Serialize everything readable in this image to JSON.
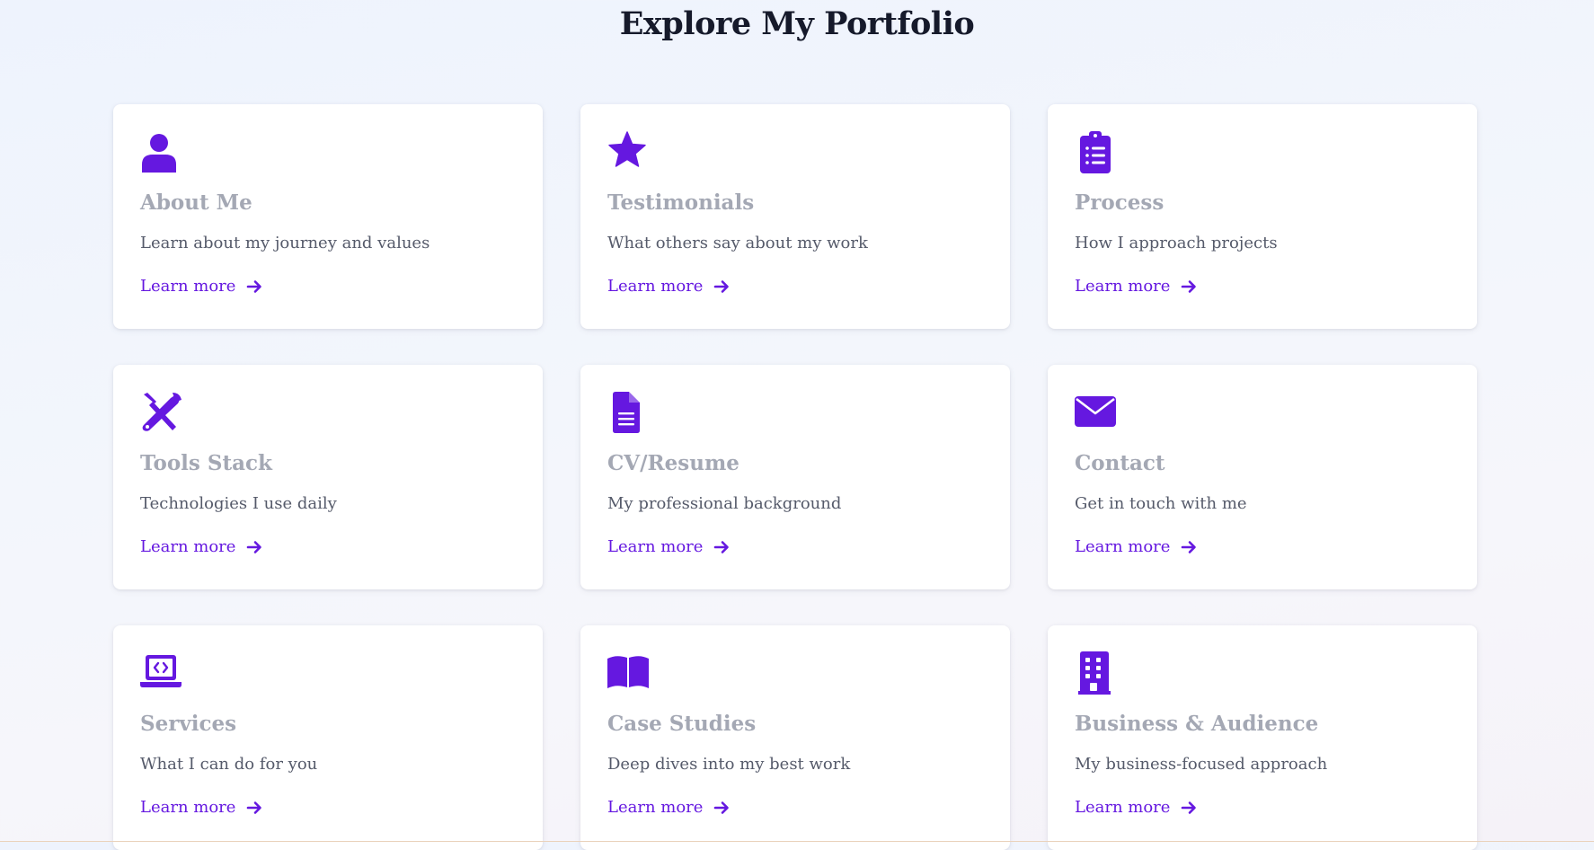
{
  "page": {
    "title": "Explore My Portfolio"
  },
  "accent_color": "#6518e0",
  "cards": [
    {
      "icon": "user-icon",
      "title": "About Me",
      "description": "Learn about my journey and values",
      "link": "Learn more"
    },
    {
      "icon": "star-icon",
      "title": "Testimonials",
      "description": "What others say about my work",
      "link": "Learn more"
    },
    {
      "icon": "clipboard-list-icon",
      "title": "Process",
      "description": "How I approach projects",
      "link": "Learn more"
    },
    {
      "icon": "tools-icon",
      "title": "Tools Stack",
      "description": "Technologies I use daily",
      "link": "Learn more"
    },
    {
      "icon": "document-icon",
      "title": "CV/Resume",
      "description": "My professional background",
      "link": "Learn more"
    },
    {
      "icon": "envelope-icon",
      "title": "Contact",
      "description": "Get in touch with me",
      "link": "Learn more"
    },
    {
      "icon": "laptop-code-icon",
      "title": "Services",
      "description": "What I can do for you",
      "link": "Learn more"
    },
    {
      "icon": "book-open-icon",
      "title": "Case Studies",
      "description": "Deep dives into my best work",
      "link": "Learn more"
    },
    {
      "icon": "building-icon",
      "title": "Business & Audience",
      "description": "My business-focused approach",
      "link": "Learn more"
    }
  ]
}
